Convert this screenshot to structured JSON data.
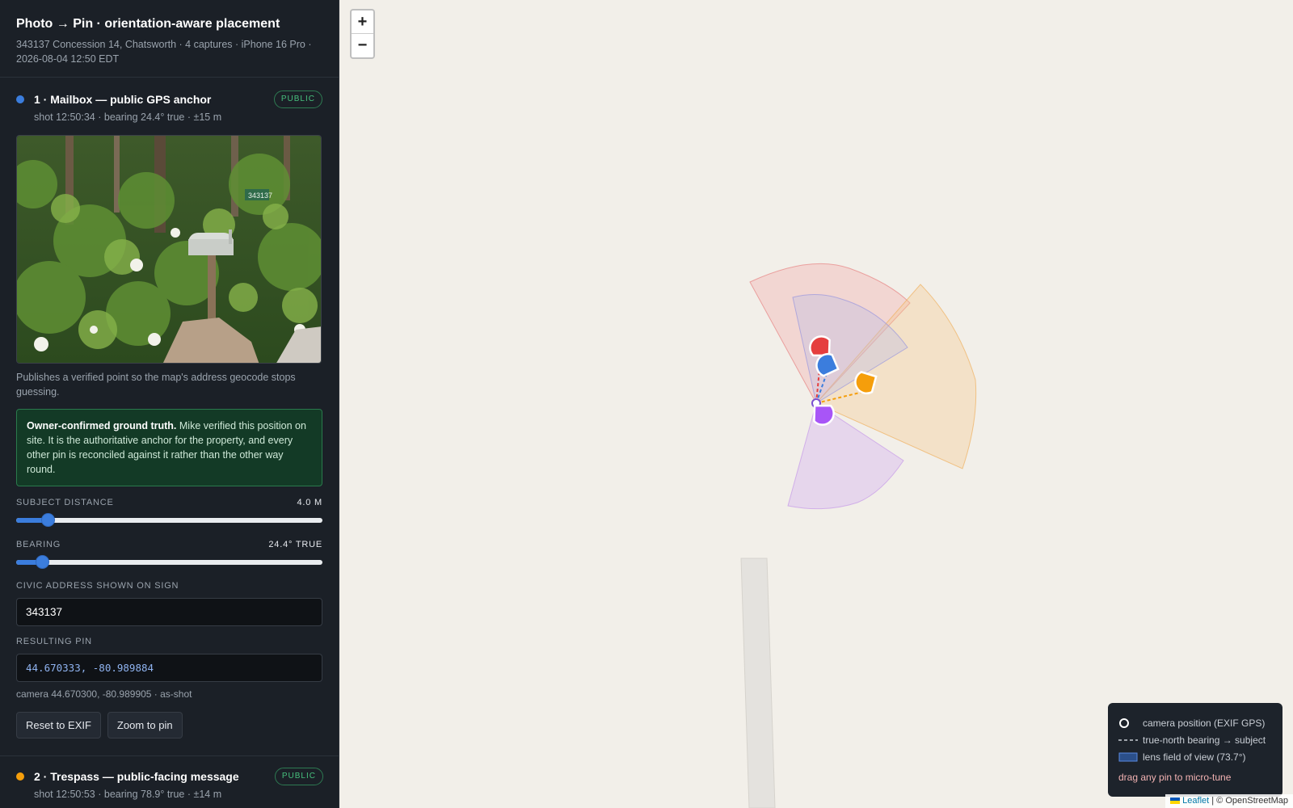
{
  "header": {
    "title": "Photo → Pin · orientation-aware placement",
    "subtitle": "343137 Concession 14, Chatsworth · 4 captures · iPhone 16 Pro · 2026-08-04 12:50 EDT"
  },
  "captures": [
    {
      "title": "1 · Mailbox — public GPS anchor",
      "badge": "PUBLIC",
      "meta": "shot 12:50:34 · bearing 24.4° true · ±15 m",
      "color": "#3b7ddd",
      "description": "Publishes a verified point so the map's address geocode stops guessing.",
      "note_bold": "Owner-confirmed ground truth.",
      "note_text": " Mike verified this position on site. It is the authoritative anchor for the property, and every other pin is reconciled against it rather than the other way round.",
      "distance_label": "SUBJECT DISTANCE",
      "distance_value": "4.0 M",
      "distance_fraction": 0.1,
      "bearing_label": "BEARING",
      "bearing_value": "24.4° TRUE",
      "bearing_fraction": 0.068,
      "address_label": "CIVIC ADDRESS SHOWN ON SIGN",
      "address_value": "343137",
      "pin_label": "RESULTING PIN",
      "pin_value": "44.670333, -80.989884",
      "camera_text": "camera 44.670300, -80.989905 · as-shot",
      "reset_label": "Reset to EXIF",
      "zoom_label": "Zoom to pin",
      "photo_sign_text": "343137"
    },
    {
      "title": "2 · Trespass — public-facing message",
      "badge": "PUBLIC",
      "meta": "shot 12:50:53 · bearing 78.9° true · ±14 m",
      "color": "#f59e0b"
    }
  ],
  "map": {
    "zoom_in": "+",
    "zoom_out": "−",
    "legend": {
      "camera": "camera position (EXIF GPS)",
      "bearing": "true-north bearing → subject",
      "fov": "lens field of view (73.7°)",
      "tip": "drag any pin to micro-tune"
    },
    "attribution_leaflet": "Leaflet",
    "attribution_rest": " | © OpenStreetMap",
    "pins": [
      {
        "name": "mailbox",
        "color": "#3b7ddd"
      },
      {
        "name": "trespass",
        "color": "#f59e0b"
      },
      {
        "name": "red",
        "color": "#e53e3e"
      },
      {
        "name": "purple",
        "color": "#a855f7"
      }
    ]
  }
}
